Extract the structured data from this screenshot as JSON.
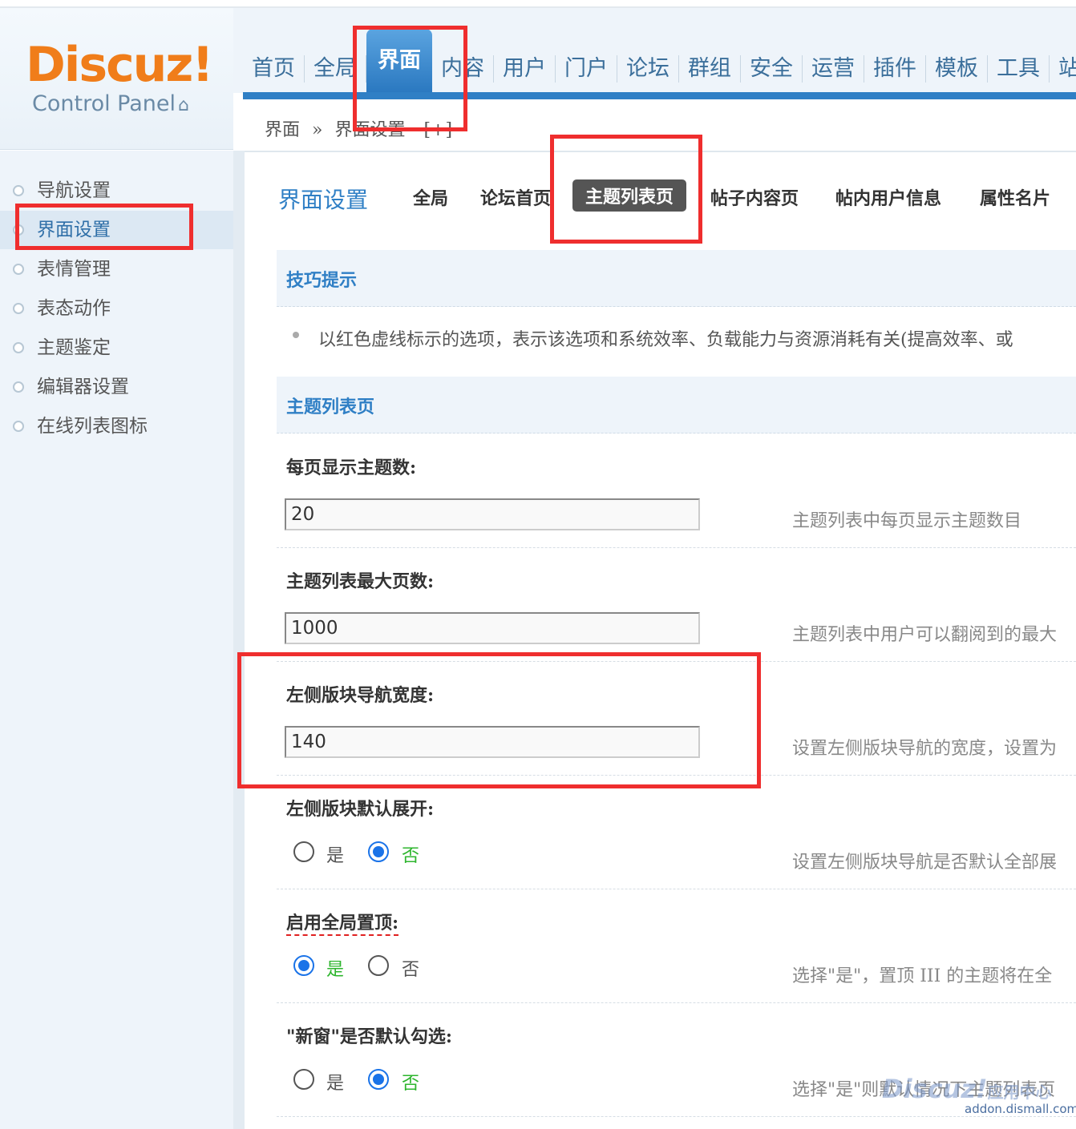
{
  "logo": {
    "brand": "Discuz!",
    "subtitle": "Control Panel",
    "icon": "home-icon"
  },
  "top_nav": [
    "首页",
    "全局",
    "界面",
    "内容",
    "用户",
    "门户",
    "论坛",
    "群组",
    "安全",
    "运营",
    "插件",
    "模板",
    "工具",
    "站"
  ],
  "top_nav_active": "界面",
  "breadcrumb": {
    "root": "界面",
    "sep": "»",
    "current": "界面设置",
    "extra": "[+]"
  },
  "sidebar": [
    "导航设置",
    "界面设置",
    "表情管理",
    "表态动作",
    "主题鉴定",
    "编辑器设置",
    "在线列表图标"
  ],
  "sidebar_active": "界面设置",
  "page": {
    "title": "界面设置",
    "tabs": [
      "全局",
      "论坛首页",
      "主题列表页",
      "帖子内容页",
      "帖内用户信息",
      "属性名片"
    ],
    "active_tab": "主题列表页"
  },
  "tips": {
    "heading": "技巧提示",
    "text": "以红色虚线标示的选项，表示该选项和系统效率、负载能力与资源消耗有关(提高效率、或"
  },
  "section": {
    "heading": "主题列表页",
    "fields": [
      {
        "label": "每页显示主题数:",
        "value": "20",
        "desc": "主题列表中每页显示主题数目"
      },
      {
        "label": "主题列表最大页数:",
        "value": "1000",
        "desc": "主题列表中用户可以翻阅到的最大"
      },
      {
        "label": "左侧版块导航宽度:",
        "value": "140",
        "desc": "设置左侧版块导航的宽度，设置为"
      }
    ],
    "radios": [
      {
        "label": "左侧版块默认展开:",
        "yes": "是",
        "no": "否",
        "selected": "否",
        "desc": "设置左侧版块导航是否默认全部展"
      },
      {
        "label": "启用全局置顶:",
        "yes": "是",
        "no": "否",
        "selected": "是",
        "desc": "选择\"是\"，置顶 III 的主题将在全"
      },
      {
        "label": "\"新窗\"是否默认勾选:",
        "yes": "是",
        "no": "否",
        "selected": "否",
        "desc": "选择\"是\"则默认情况下主题列表页"
      }
    ]
  },
  "watermark": {
    "brand": "Discuz!",
    "sub": "应用中心",
    "url": "addon.dismall.com"
  },
  "colors": {
    "accent": "#2f7fc5",
    "logo": "#f07d1a",
    "highlight": "#ef2e2e",
    "radio_on": "#1a73e8",
    "selected_text": "#2db52d"
  }
}
